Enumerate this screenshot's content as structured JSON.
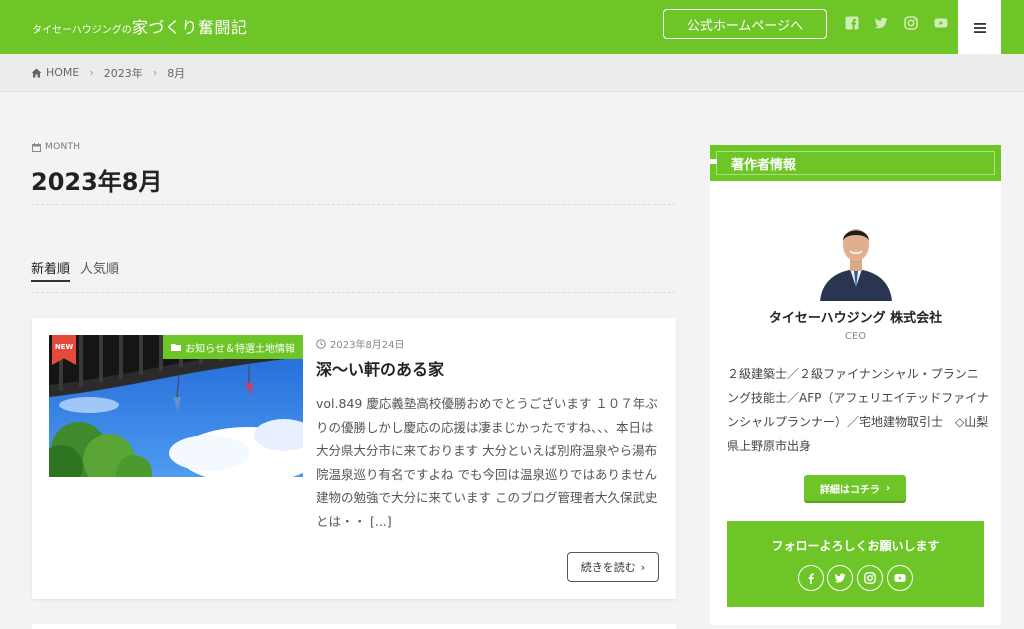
{
  "header": {
    "logo_small": "タイセーハウジングの",
    "logo_big": "家づくり奮闘記",
    "hp_button": "公式ホームページへ",
    "social_icons": [
      "facebook-icon",
      "twitter-icon",
      "instagram-icon",
      "youtube-icon"
    ],
    "menu_icon": "hamburger-icon"
  },
  "breadcrumb": {
    "home": "HOME",
    "year": "2023年",
    "month": "8月"
  },
  "archive": {
    "label": "MONTH",
    "title": "2023年8月"
  },
  "sort": {
    "newest": "新着順",
    "popular": "人気順"
  },
  "post": {
    "badge_new": "NEW",
    "category": "お知らせ＆特選土地情報",
    "date": "2023年8月24日",
    "title": "深〜い軒のある家",
    "excerpt": "vol.849 慶応義塾高校優勝おめでとうございます １０７年ぶりの優勝しかし慶応の応援は凄まじかったですね、、、本日は大分県大分市に来ております 大分といえば別府温泉やら湯布院温泉巡り有名ですよね でも今回は温泉巡りではありません 建物の勉強で大分に来ています このブログ管理者大久保武史とは・・ [...]",
    "read_more": "続きを読む"
  },
  "sidebar": {
    "widget_title": "著作者情報",
    "author_name": "タイセーハウジング 株式会社",
    "author_role": "CEO",
    "bio": "２級建築士／２級ファイナンシャル・プランニング技能士／AFP（アフェリエイテッドファイナンシャルプランナー）／宅地建物取引士　◇山梨県上野原市出身",
    "detail_button": "詳細はコチラ",
    "follow_title": "フォローよろしくお願いします",
    "follow_icons": [
      "facebook-icon",
      "twitter-icon",
      "instagram-icon",
      "youtube-icon"
    ]
  },
  "colors": {
    "brand_green": "#6ec527",
    "new_badge": "#e34a3b",
    "background": "#f3f3f3"
  }
}
